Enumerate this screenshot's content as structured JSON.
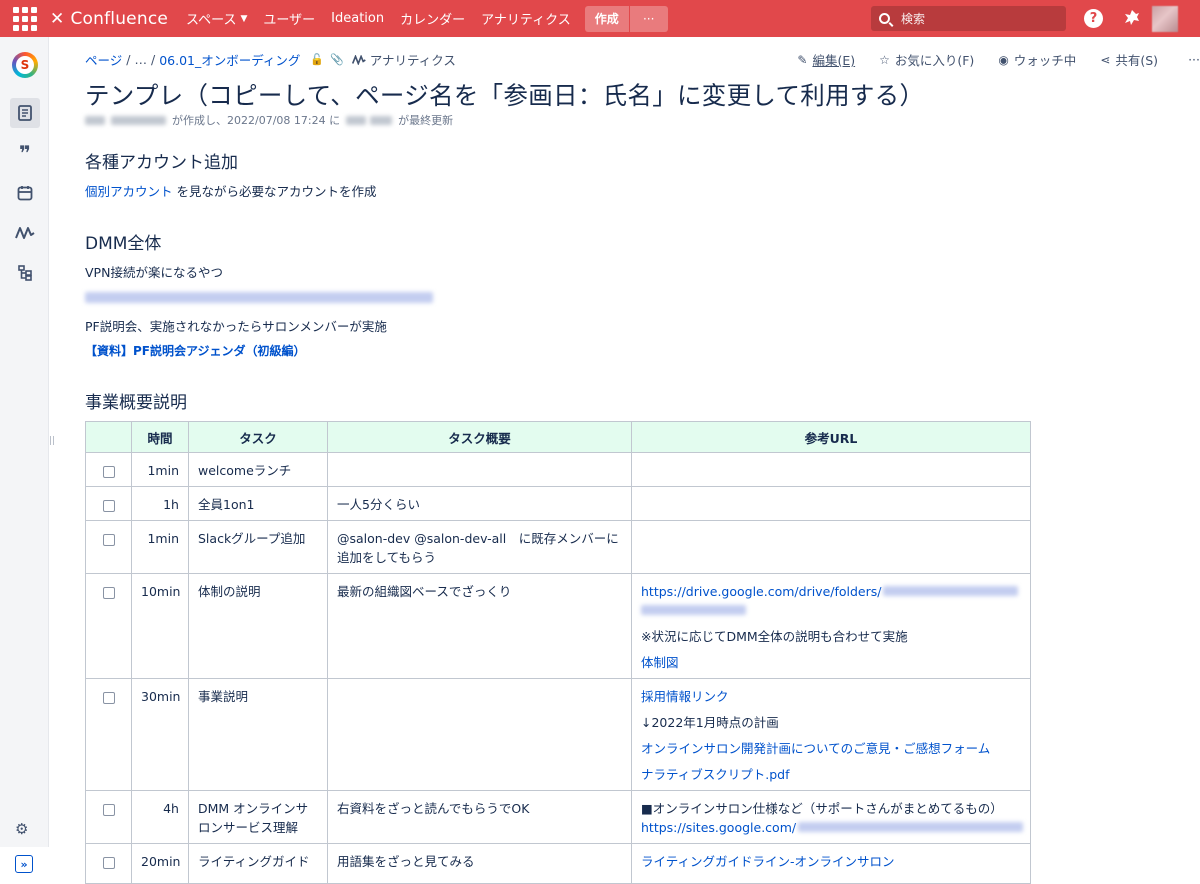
{
  "topbar": {
    "app_name": "Confluence",
    "nav": [
      {
        "label": "スペース",
        "has_dropdown": true
      },
      {
        "label": "ユーザー"
      },
      {
        "label": "Ideation"
      },
      {
        "label": "カレンダー"
      },
      {
        "label": "アナリティクス"
      }
    ],
    "create_label": "作成",
    "more_label": "···",
    "search_placeholder": "検索",
    "help_glyph": "?",
    "colors": {
      "brand": "#e1484b"
    }
  },
  "leftrail": {
    "space_logo_letter": "S",
    "items": [
      {
        "icon": "pages-icon"
      },
      {
        "icon": "blog-quote-icon"
      },
      {
        "icon": "calendar-icon"
      },
      {
        "icon": "analytics-icon"
      },
      {
        "icon": "hierarchy-icon"
      }
    ]
  },
  "breadcrumb": {
    "root": "ページ",
    "ellipsis": "…",
    "parent": "06.01_オンボーディング",
    "analytics": "アナリティクス"
  },
  "actions": {
    "edit": "編集(E)",
    "favorite": "お気に入り(F)",
    "watch": "ウォッチ中",
    "share": "共有(S)",
    "more": "···"
  },
  "page": {
    "title": "テンプレ（コピーして、ページ名を「参画日：氏名」に変更して利用する）",
    "byline_created": "が作成し、2022/07/08 17:24 に",
    "byline_updated": "が最終更新"
  },
  "sections": {
    "accounts": {
      "heading": "各種アカウント追加",
      "link": "個別アカウント",
      "text": " を見ながら必要なアカウントを作成"
    },
    "dmm": {
      "heading": "DMM全体",
      "vpn_text": "VPN接続が楽になるやつ",
      "pf_text": "PF説明会、実施されなかったらサロンメンバーが実施",
      "pf_link": "【資料】PF説明会アジェンダ（初級編）"
    },
    "business": {
      "heading": "事業概要説明"
    }
  },
  "table": {
    "headers": [
      "",
      "時間",
      "タスク",
      "タスク概要",
      "参考URL"
    ],
    "rows": [
      {
        "time": "1min",
        "task": "welcomeランチ",
        "summary": "",
        "urls": []
      },
      {
        "time": "1h",
        "task": "全員1on1",
        "summary": "一人5分くらい",
        "urls": []
      },
      {
        "time": "1min",
        "task": "Slackグループ追加",
        "summary": "@salon-dev @salon-dev-all　に既存メンバーに追加をしてもらう",
        "urls": []
      },
      {
        "time": "10min",
        "task": "体制の説明",
        "summary": "最新の組織図ベースでざっくり",
        "urls": [
          {
            "text": "https://drive.google.com/drive/folders/",
            "link": true,
            "blurred_tail": true
          },
          {
            "text": "※状況に応じてDMM全体の説明も合わせて実施",
            "link": false
          },
          {
            "text": "体制図",
            "link": true
          }
        ]
      },
      {
        "time": "30min",
        "task": "事業説明",
        "summary": "",
        "urls": [
          {
            "text": "採用情報リンク",
            "link": true
          },
          {
            "text": "↓2022年1月時点の計画",
            "link": false
          },
          {
            "text": "オンラインサロン開発計画についてのご意見・ご感想フォーム",
            "link": true
          },
          {
            "text": "ナラティブスクリプト.pdf",
            "link": true
          }
        ]
      },
      {
        "time": "4h",
        "task": "DMM オンラインサロンサービス理解",
        "summary": "右資料をざっと読んでもらうでOK",
        "urls": [
          {
            "text": "■オンラインサロン仕様など（サポートさんがまとめてるもの）",
            "link": false
          },
          {
            "text": "https://sites.google.com/",
            "link": true,
            "blurred_tail": true
          }
        ]
      },
      {
        "time": "20min",
        "task": "ライティングガイド",
        "summary": "用語集をざっと見てみる",
        "urls": [
          {
            "text": "ライティングガイドライン-オンラインサロン",
            "link": true
          }
        ]
      }
    ]
  }
}
